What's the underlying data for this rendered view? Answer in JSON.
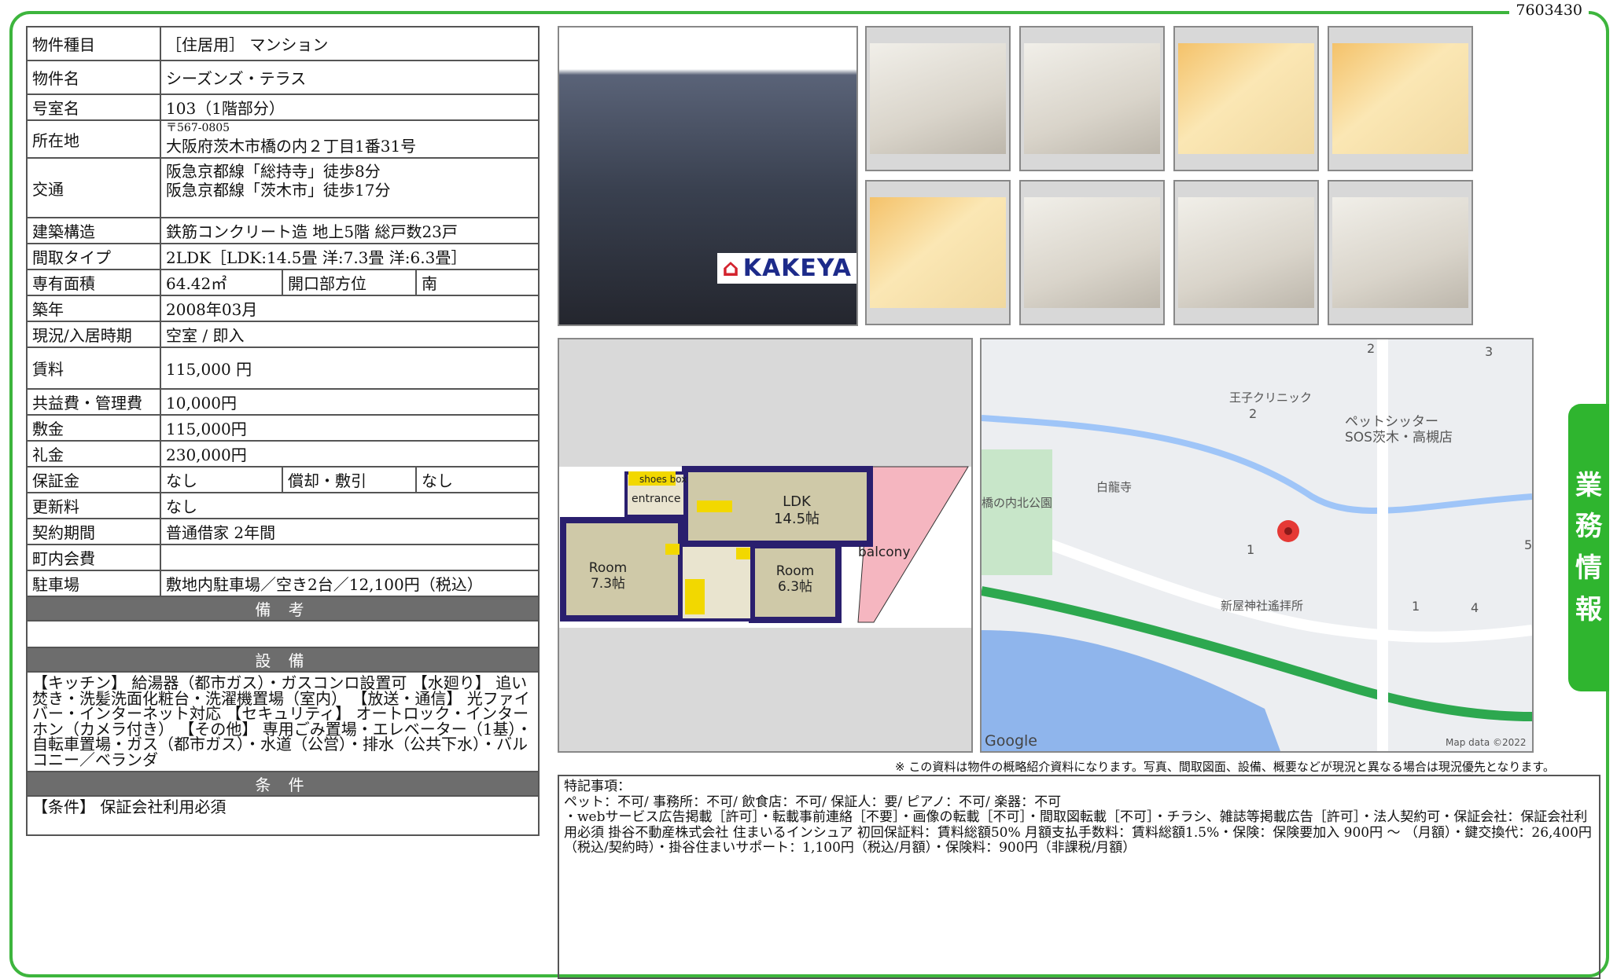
{
  "doc_id": "7603430",
  "side_tab": [
    "業",
    "務",
    "情",
    "報"
  ],
  "property": {
    "type_label": "物件種目",
    "type_value": "［住居用］ マンション",
    "name_label": "物件名",
    "name_value": "シーズンズ・テラス",
    "room_label": "号室名",
    "room_value": "103（1階部分）",
    "addr_label": "所在地",
    "postal": "〒567-0805",
    "address": "大阪府茨木市橋の内２丁目1番31号",
    "access_label": "交通",
    "access1": "阪急京都線「総持寺」徒歩8分",
    "access2": "阪急京都線「茨木市」徒歩17分",
    "structure_label": "建築構造",
    "structure_value": "鉄筋コンクリート造 地上5階 総戸数23戸",
    "layout_label": "間取タイプ",
    "layout_value": "2LDK［LDK:14.5畳 洋:7.3畳 洋:6.3畳］",
    "area_label": "専有面積",
    "area_value": "64.42㎡",
    "orient_label": "開口部方位",
    "orient_value": "南",
    "built_label": "築年",
    "built_value": "2008年03月",
    "status_label": "現況/入居時期",
    "status_value": "空室 / 即入",
    "rent_label": "賃料",
    "rent_value": "115,000 円",
    "fee_label": "共益費・管理費",
    "fee_value": "10,000円",
    "deposit_label": "敷金",
    "deposit_value": "115,000円",
    "key_label": "礼金",
    "key_value": "230,000円",
    "guar_label": "保証金",
    "guar_value": "なし",
    "amort_label": "償却・敷引",
    "amort_value": "なし",
    "renew_label": "更新料",
    "renew_value": "なし",
    "contract_label": "契約期間",
    "contract_value": "普通借家 2年間",
    "town_label": "町内会費",
    "town_value": "",
    "parking_label": "駐車場",
    "parking_value": "敷地内駐車場／空き2台／12,100円（税込）"
  },
  "remarks_header": "備 考",
  "facilities_header": "設 備",
  "facilities_text": "【キッチン】 給湯器（都市ガス）・ガスコンロ設置可 【水廻り】 追い焚き・洗髪洗面化粧台・洗濯機置場（室内） 【放送・通信】 光ファイバー・インターネット対応 【セキュリティ】 オートロック・インターホン（カメラ付き） 【その他】 専用ごみ置場・エレベーター（1基）・自転車置場・ガス（都市ガス）・水道（公営）・排水（公共下水）・バルコニー／ベランダ",
  "conditions_header": "条 件",
  "conditions_text": "【条件】 保証会社利用必須",
  "logo_text": "KAKEYA",
  "floorplan": {
    "shoes_box": "shoes box",
    "entrance": "entrance",
    "ldk": "LDK",
    "ldk_size": "14.5帖",
    "room1": "Room",
    "room1_size": "7.3帖",
    "room2": "Room",
    "room2_size": "6.3帖",
    "balcony": "balcony"
  },
  "map": {
    "clinic": "王子クリニック",
    "petsitter1": "ペットシッター",
    "petsitter2": "SOS茨木・高槻店",
    "park": "橋の内北公園",
    "temple": "白龍寺",
    "shrine": "新屋神社遙拝所",
    "google": "Google",
    "copyright": "Map data ©2022",
    "n2a": "2",
    "n2b": "2",
    "n3": "3",
    "n1a": "1",
    "n1b": "1",
    "n4": "4",
    "n5": "5"
  },
  "disclaimer": "※ この資料は物件の概略紹介資料になります。写真、間取図面、設備、概要などが現況と異なる場合は現況優先となります。",
  "special_title": "特記事項：",
  "special_line1": "ペット：不可/ 事務所：不可/ 飲食店：不可/ 保証人：要/ ピアノ：不可/ 楽器：不可",
  "special_line2": "・webサービス広告掲載［許可］・転載事前連絡［不要］・画像の転載［不可］・間取図転載［不可］・チラシ、雑誌等掲載広告［許可］・法人契約可・保証会社：保証会社利用必須 掛谷不動産株式会社 住まいるインシュア 初回保証料：賃料総額50% 月額支払手数料：賃料総額1.5%・保険：保険要加入 900円 ～ （月額）・鍵交換代：26,400円（税込/契約時）・掛谷住まいサポート：1,100円（税込/月額）・保険料：900円（非課税/月額）"
}
